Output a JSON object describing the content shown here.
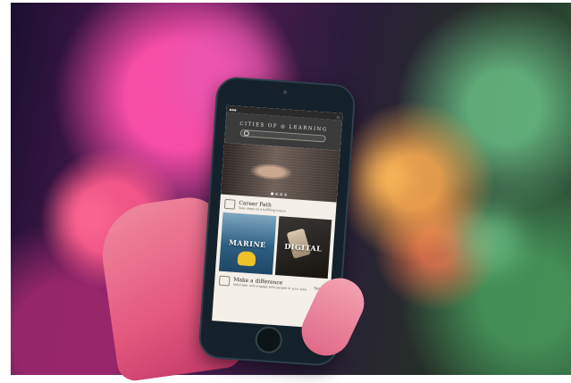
{
  "app": {
    "logo_text": "CITIES OF ◎ LEARNING",
    "search_placeholder": ""
  },
  "carousel": {
    "dots": 4,
    "active_index": 0
  },
  "sections": {
    "career": {
      "title": "Career Path",
      "subtitle": "Take steps to a fulfilling future"
    },
    "difference": {
      "title": "Make a difference",
      "subtitle": "Volunteer and engage with people in your area",
      "see_all": "See all"
    }
  },
  "cards": [
    {
      "label": "MARINE"
    },
    {
      "label": "DIGITAL"
    }
  ],
  "colors": {
    "header_bg": "#3b3b3b",
    "screen_bg": "#f4efe8",
    "phone_frame": "#14202a"
  }
}
